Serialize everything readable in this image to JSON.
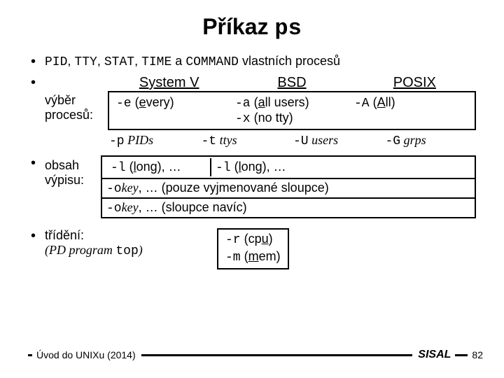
{
  "title": {
    "pre": "Příkaz ",
    "cmd": "ps"
  },
  "line1": {
    "a": "PID",
    "b": "TTY",
    "c": "STAT",
    "d": "TIME",
    "conj": " a ",
    "e": "COMMAND",
    "rest": " vlastních procesů"
  },
  "sel": {
    "label1": "výběr",
    "label2": "procesů:",
    "h1": "System V",
    "h2": "BSD",
    "h3": "POSIX",
    "sv": {
      "flag": "-e",
      "open": " (",
      "u": "e",
      "rest": "very)"
    },
    "bsd1": {
      "flag": "-a",
      "open": " (",
      "u": "a",
      "rest": "ll users)"
    },
    "bsd2": {
      "flag": "-x",
      "rest": " (no tty)"
    },
    "px": {
      "flag": "-A",
      "open": " (",
      "u": "A",
      "rest": "ll)"
    },
    "f1": {
      "flag": "-p",
      "arg": " PIDs"
    },
    "f2": {
      "flag": "-t",
      "arg": " ttys"
    },
    "f3": {
      "flag": "-U",
      "arg": " users"
    },
    "f4": {
      "flag": "-G",
      "arg": " grps"
    }
  },
  "content": {
    "label1": "obsah",
    "label2": "výpisu:",
    "sv": {
      "flag": "-l",
      "open": " (",
      "u": "l",
      "rest": "ong), …"
    },
    "bsd": {
      "flag": "-l",
      "open": " (",
      "u": "l",
      "rest": "ong), …"
    },
    "o1": {
      "flag": "-o",
      "key": "key",
      "rest": ", … (pouze vyjmenované sloupce)"
    },
    "o2": {
      "flag": "-o",
      "key": "key",
      "rest": ", … (sloupce navíc)"
    }
  },
  "sort": {
    "label": "třídění:",
    "sub_open": "(PD program ",
    "sub_cmd": "top",
    "sub_close": ")",
    "r": {
      "flag": "-r",
      "open": " (cp",
      "u": "u",
      "close": ")"
    },
    "m": {
      "flag": "-m",
      "open": " (",
      "u": "m",
      "rest": "em)"
    }
  },
  "footer": {
    "text": "Úvod do UNIXu (2014)",
    "brand": "SISAL",
    "page": "82"
  }
}
